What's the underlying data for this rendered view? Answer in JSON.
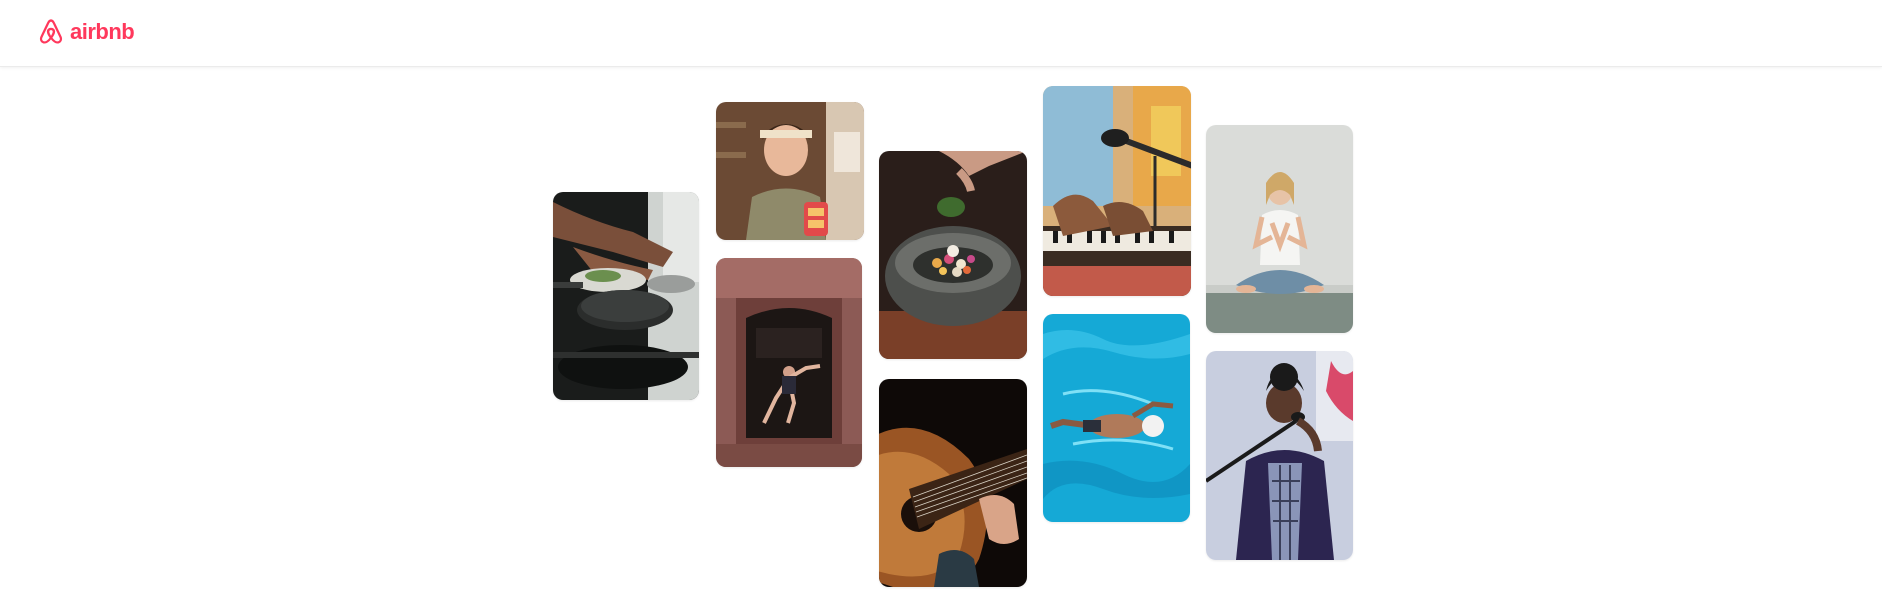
{
  "header": {
    "logo_text": "airbnb",
    "brand_color": "#FF385C",
    "logo_icon": "airbnb-belo-icon"
  },
  "collage": {
    "tiles": [
      {
        "subject": "cooking-pans-photo"
      },
      {
        "subject": "woman-holding-food-photo"
      },
      {
        "subject": "dancer-in-doorway-photo"
      },
      {
        "subject": "bowl-with-garnish-photo"
      },
      {
        "subject": "acoustic-guitar-photo"
      },
      {
        "subject": "keyboard-and-microphone-photo"
      },
      {
        "subject": "swimmer-in-pool-photo"
      },
      {
        "subject": "woman-meditating-photo"
      },
      {
        "subject": "singer-with-microphone-photo"
      }
    ]
  }
}
